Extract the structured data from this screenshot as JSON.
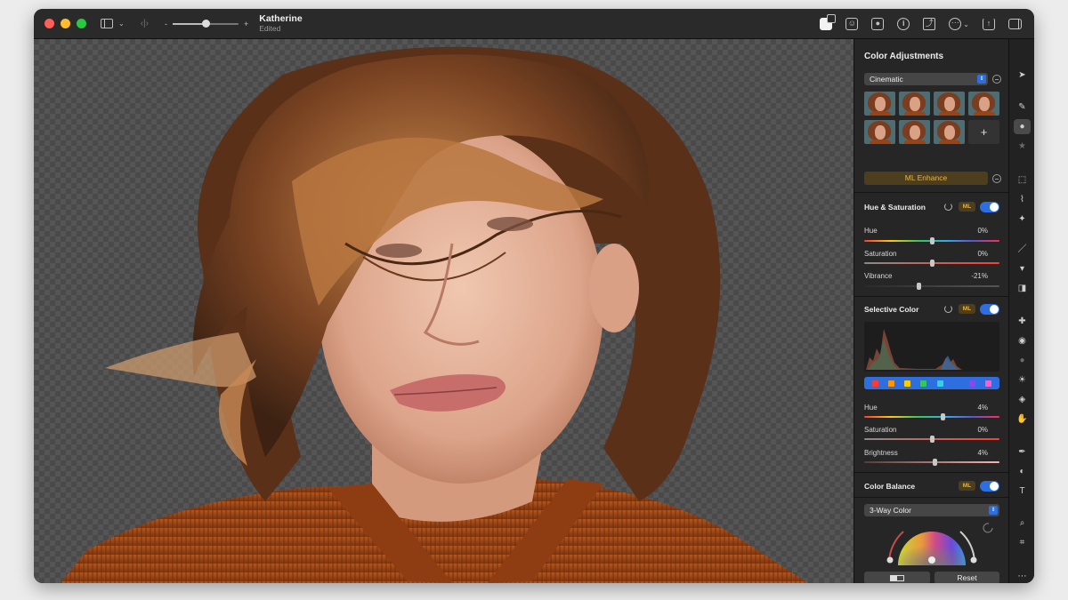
{
  "window": {
    "document_name": "Katherine",
    "document_status": "Edited",
    "zoom_level": 0.5
  },
  "panel": {
    "title": "Color Adjustments",
    "preset_select": "Cinematic",
    "ml_enhance_label": "ML Enhance",
    "hue_saturation": {
      "title": "Hue & Saturation",
      "ml_badge": "ML",
      "sliders": [
        {
          "label": "Hue",
          "value": "0%",
          "position": 0.5
        },
        {
          "label": "Saturation",
          "value": "0%",
          "position": 0.5
        },
        {
          "label": "Vibrance",
          "value": "-21%",
          "position": 0.4
        }
      ]
    },
    "selective_color": {
      "title": "Selective Color",
      "ml_badge": "ML",
      "swatch_colors": [
        "#ff3b30",
        "#ff9500",
        "#ffcc00",
        "#34c759",
        "#32d2e6",
        "#2d6fe0",
        "#8e44ef",
        "#ff5ec8"
      ],
      "sliders": [
        {
          "label": "Hue",
          "value": "4%",
          "position": 0.58
        },
        {
          "label": "Saturation",
          "value": "0%",
          "position": 0.5
        },
        {
          "label": "Brightness",
          "value": "4%",
          "position": 0.52
        }
      ]
    },
    "color_balance": {
      "title": "Color Balance",
      "ml_badge": "ML",
      "mode_select": "3-Way Color"
    },
    "footer": {
      "compare_icon": "compare-icon",
      "reset_label": "Reset"
    }
  },
  "colors": {
    "accent": "#2d6fe0",
    "ml_gold": "#e8b54a"
  }
}
